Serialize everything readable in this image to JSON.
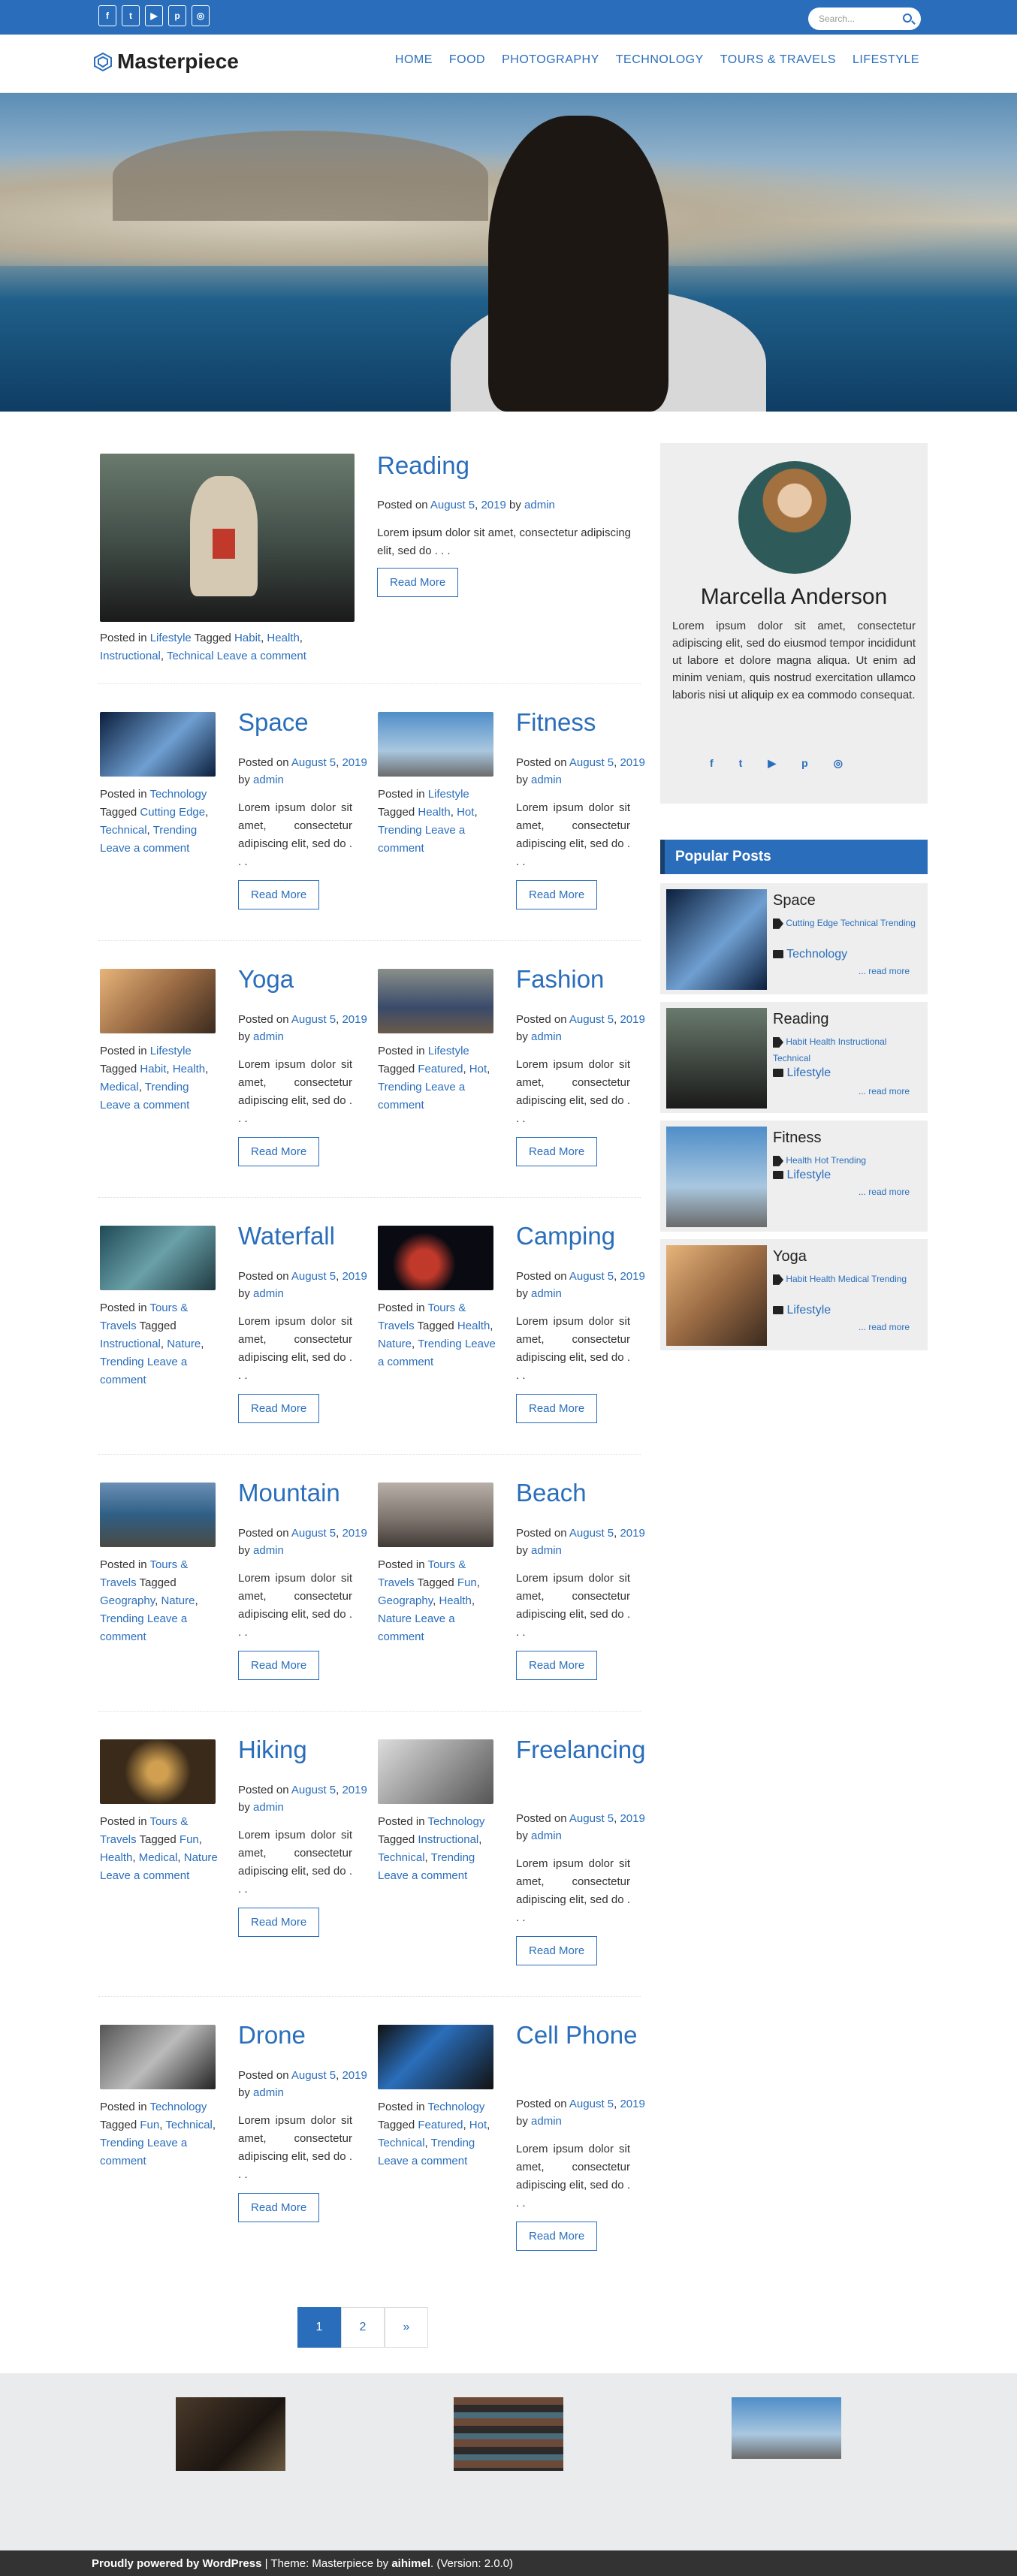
{
  "social": {
    "facebook": "f",
    "twitter": "t",
    "youtube": "▶",
    "pinterest": "p",
    "instagram": "◎"
  },
  "search": {
    "placeholder": "Search..."
  },
  "site": {
    "title": "Masterpiece"
  },
  "nav": [
    "HOME",
    "FOOD",
    "PHOTOGRAPHY",
    "TECHNOLOGY",
    "TOURS & TRAVELS",
    "LIFESTYLE"
  ],
  "labels": {
    "posted_on": "Posted on",
    "by": "by",
    "posted_in": "Posted in",
    "tagged": "Tagged",
    "leave_comment": "Leave a comment",
    "read_more": "Read More"
  },
  "featured": {
    "title": "Reading",
    "date_a": "August 5",
    "date_b": "2019",
    "author": "admin",
    "excerpt": "Lorem ipsum dolor sit amet, consectetur adipiscing elit, sed do . . .",
    "cat": "Lifestyle",
    "tags": [
      "Habit",
      "Health",
      "Instructional",
      "Technical"
    ]
  },
  "posts": [
    {
      "title": "Space",
      "cat": "Technology",
      "tags": [
        "Cutting Edge",
        "Technical",
        "Trending"
      ]
    },
    {
      "title": "Fitness",
      "cat": "Lifestyle",
      "tags": [
        "Health",
        "Hot",
        "Trending"
      ]
    },
    {
      "title": "Yoga",
      "cat": "Lifestyle",
      "tags": [
        "Habit",
        "Health",
        "Medical",
        "Trending"
      ]
    },
    {
      "title": "Fashion",
      "cat": "Lifestyle",
      "tags": [
        "Featured",
        "Hot",
        "Trending"
      ]
    },
    {
      "title": "Waterfall",
      "cat": "Tours & Travels",
      "tags": [
        "Instructional",
        "Nature",
        "Trending"
      ]
    },
    {
      "title": "Camping",
      "cat": "Tours & Travels",
      "tags": [
        "Health",
        "Nature",
        "Trending"
      ]
    },
    {
      "title": "Mountain",
      "cat": "Tours & Travels",
      "tags": [
        "Geography",
        "Nature",
        "Trending"
      ]
    },
    {
      "title": "Beach",
      "cat": "Tours & Travels",
      "tags": [
        "Fun",
        "Geography",
        "Health",
        "Nature"
      ]
    },
    {
      "title": "Hiking",
      "cat": "Tours & Travels",
      "tags": [
        "Fun",
        "Health",
        "Medical",
        "Nature"
      ]
    },
    {
      "title": "Freelancing",
      "cat": "Technology",
      "tags": [
        "Instructional",
        "Technical",
        "Trending"
      ]
    },
    {
      "title": "Drone",
      "cat": "Technology",
      "tags": [
        "Fun",
        "Technical",
        "Trending"
      ]
    },
    {
      "title": "Cell Phone",
      "cat": "Technology",
      "tags": [
        "Featured",
        "Hot",
        "Technical",
        "Trending"
      ]
    }
  ],
  "post_date_a": "August 5",
  "post_date_b": "2019",
  "post_author": "admin",
  "post_excerpt": "Lorem ipsum dolor sit amet, consectetur adipiscing elit, sed do . . .",
  "sidebar": {
    "name": "Marcella Anderson",
    "bio": "Lorem ipsum dolor sit amet, consectetur adipiscing elit, sed do eiusmod tempor incididunt ut labore et dolore magna aliqua. Ut enim ad minim veniam, quis nostrud exercitation ullamco laboris nisi ut aliquip ex ea commodo consequat.",
    "social": [
      "f",
      "t",
      "▶",
      "p",
      "◎"
    ],
    "popular_title": "Popular Posts",
    "popular": [
      {
        "title": "Space",
        "tags": "Cutting Edge Technical Trending",
        "cat": "Technology"
      },
      {
        "title": "Reading",
        "tags": "Habit Health Instructional Technical",
        "cat": "Lifestyle"
      },
      {
        "title": "Fitness",
        "tags": "Health Hot Trending",
        "cat": "Lifestyle"
      },
      {
        "title": "Yoga",
        "tags": "Habit Health Medical Trending",
        "cat": "Lifestyle"
      }
    ],
    "read_more": "... read more"
  },
  "pagination": [
    "1",
    "2",
    "»"
  ],
  "footer": {
    "powered": "Proudly powered by WordPress",
    "sep": " | Theme: Masterpiece by ",
    "author": "aihimel",
    "version": ". (Version: 2.0.0)"
  },
  "colors": {
    "accent": "#2a6ebb",
    "footer": "#333333"
  }
}
